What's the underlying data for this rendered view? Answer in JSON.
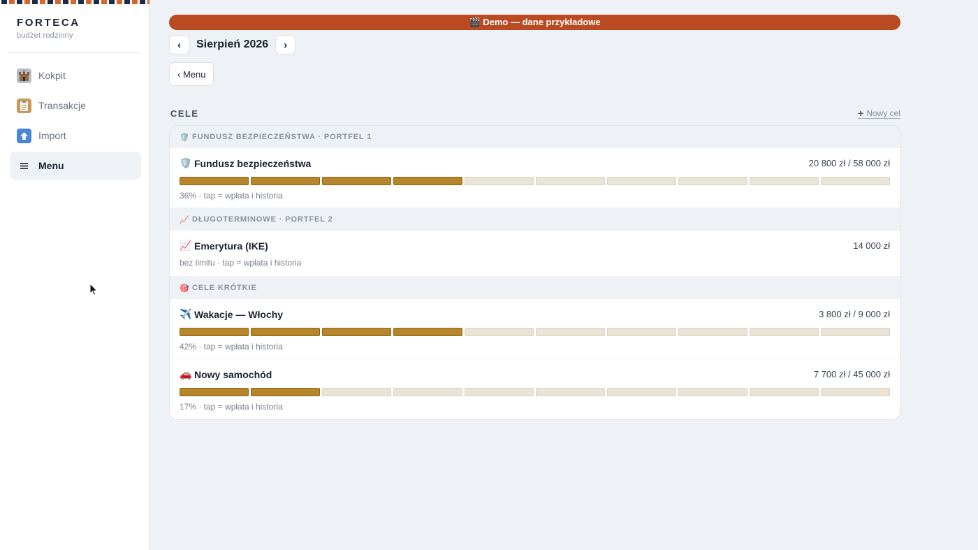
{
  "sidebar": {
    "brand": "FORTECA",
    "tagline": "budżet rodzinny",
    "items": [
      {
        "label": "Kokpit",
        "icon": "castle-icon",
        "active": false
      },
      {
        "label": "Transakcje",
        "icon": "clipboard-icon",
        "active": false
      },
      {
        "label": "Import",
        "icon": "upload-arrow-icon",
        "active": false
      },
      {
        "label": "Menu",
        "icon": "hamburger-menu-icon",
        "active": true
      }
    ]
  },
  "banner": {
    "icon": "clapper-board-icon",
    "text": "🎬 Demo — dane przykładowe"
  },
  "month_nav": {
    "prev": "‹",
    "label": "Sierpień 2026",
    "next": "›"
  },
  "back_button": "‹ Menu",
  "goals_section": {
    "title": "CELE",
    "new_goal": "Nowy cel",
    "groups": [
      {
        "icon": "shield-icon",
        "label": "FUNDUSZ BEZPIECZEŃSTWA · PORTFEL 1",
        "goals": [
          {
            "icon": "shield-icon",
            "name": "Fundusz bezpieczeństwa",
            "amount": "20 800 zł / 58 000 zł",
            "progress": 0.36,
            "sub": "36% · tap = wpłata i historia"
          }
        ]
      },
      {
        "icon": "chart-increasing-icon",
        "label": "DŁUGOTERMINOWE · PORTFEL 2",
        "goals": [
          {
            "icon": "chart-increasing-icon",
            "name": "Emerytura (IKE)",
            "amount": "14 000 zł",
            "progress": null,
            "sub": "bez limitu · tap = wpłata i historia"
          }
        ]
      },
      {
        "icon": "target-icon",
        "label": "CELE KRÓTKIE",
        "goals": [
          {
            "icon": "airplane-icon",
            "name": "Wakacje — Włochy",
            "amount": "3 800 zł / 9 000 zł",
            "progress": 0.42,
            "sub": "42% · tap = wpłata i historia"
          },
          {
            "icon": "car-icon",
            "name": "Nowy samochód",
            "amount": "7 700 zł / 45 000 zł",
            "progress": 0.17,
            "sub": "17% · tap = wpłata i historia"
          }
        ]
      }
    ]
  },
  "colors": {
    "accent": "#b94a21",
    "progress_fill": "#b8862a",
    "progress_empty": "#e9e4d6",
    "background": "#eef1f5"
  }
}
